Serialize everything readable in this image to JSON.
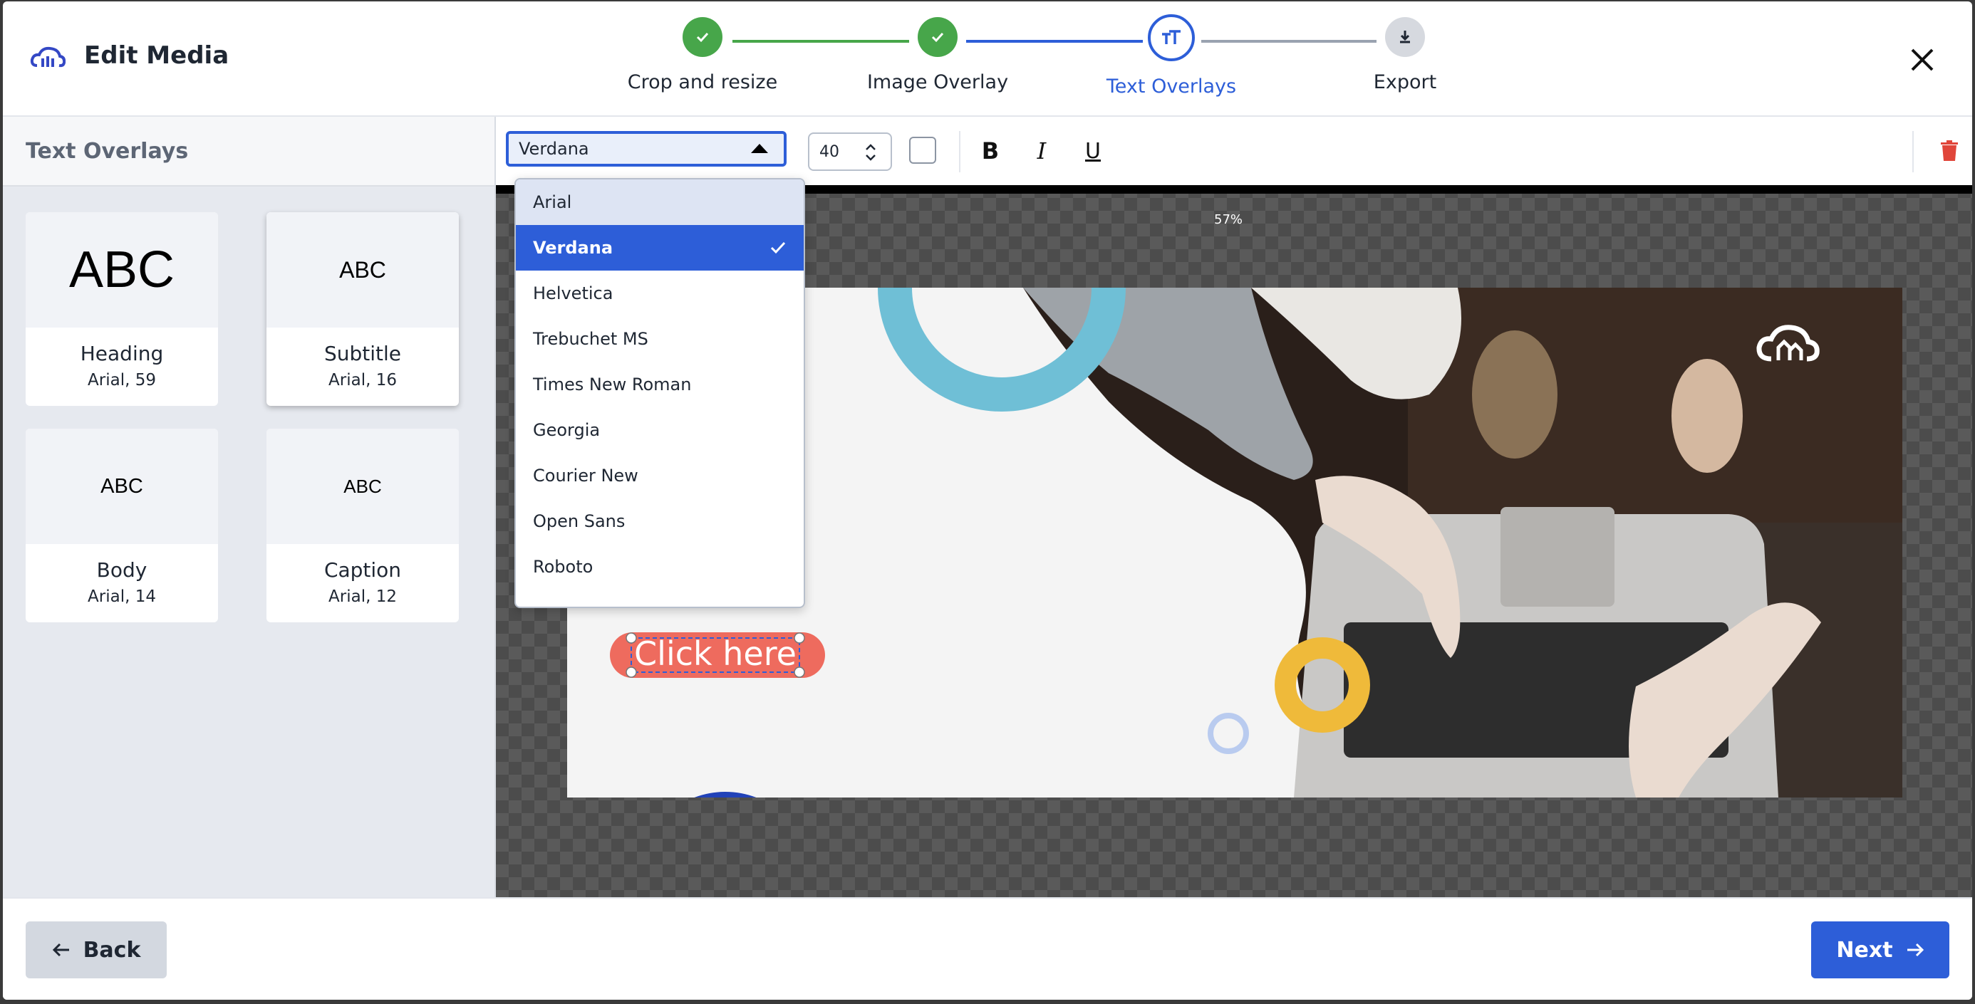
{
  "header": {
    "title": "Edit Media",
    "steps": [
      {
        "label": "Crop and resize",
        "state": "done"
      },
      {
        "label": "Image Overlay",
        "state": "done"
      },
      {
        "label": "Text Overlays",
        "state": "active"
      },
      {
        "label": "Export",
        "state": "pending"
      }
    ]
  },
  "left_panel": {
    "title": "Text Overlays",
    "presets": [
      {
        "sample": "ABC",
        "name": "Heading",
        "meta": "Arial, 59"
      },
      {
        "sample": "ABC",
        "name": "Subtitle",
        "meta": "Arial, 16"
      },
      {
        "sample": "ABC",
        "name": "Body",
        "meta": "Arial, 14"
      },
      {
        "sample": "ABC",
        "name": "Caption",
        "meta": "Arial, 12"
      }
    ]
  },
  "toolbar": {
    "font_value": "Verdana",
    "font_size": "40",
    "bold": "B",
    "italic": "I",
    "underline": "U"
  },
  "font_menu": {
    "options": [
      "Arial",
      "Verdana",
      "Helvetica",
      "Trebuchet MS",
      "Times New Roman",
      "Georgia",
      "Courier New",
      "Open Sans",
      "Roboto"
    ],
    "selected": "Verdana"
  },
  "canvas": {
    "zoom": "57%",
    "overlay_text": "Click here"
  },
  "footer": {
    "back_label": "Back",
    "next_label": "Next"
  },
  "colors": {
    "accent": "#2d5ed8",
    "done": "#47a64a",
    "button_text": "#ee6b5e",
    "danger": "#e0453a"
  }
}
